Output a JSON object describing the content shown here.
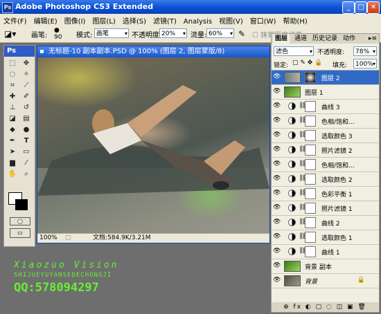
{
  "app": {
    "title": "Adobe Photoshop CS3 Extended",
    "logo": "Ps"
  },
  "window_controls": {
    "minimize": "_",
    "maximize": "□",
    "close": "✕"
  },
  "menu": [
    "文件(F)",
    "编辑(E)",
    "图像(I)",
    "图层(L)",
    "选择(S)",
    "滤镜(T)",
    "Analysis",
    "视图(V)",
    "窗口(W)",
    "帮助(H)"
  ],
  "options": {
    "brush_label": "画笔:",
    "brush_size": "90",
    "mode_label": "模式:",
    "mode_value": "画笔",
    "opacity_label": "不透明度:",
    "opacity_value": "20%",
    "flow_label": "流量:",
    "flow_value": "60%",
    "history_check_label": "抹到历史记录"
  },
  "toolbox": {
    "header": "Ps"
  },
  "document": {
    "title": "无标题-10 副本副本.PSD @ 100% (图层 2, 图层蒙版/8)",
    "zoom": "100%",
    "doc_info": "文档:584.9K/3.21M"
  },
  "layers_panel": {
    "tabs": [
      "图层",
      "通道",
      "历史记录",
      "动作"
    ],
    "blend_mode": "滤色",
    "opacity_label": "不透明度:",
    "opacity_value": "78%",
    "lock_label": "锁定:",
    "fill_label": "填充:",
    "fill_value": "100%",
    "layers": [
      {
        "name": "图层 2",
        "type": "pixel-mask",
        "selected": true
      },
      {
        "name": "图层 1",
        "type": "pixel"
      },
      {
        "name": "曲线 3",
        "type": "adjustment"
      },
      {
        "name": "色相/饱和...",
        "type": "adjustment"
      },
      {
        "name": "选取颜色 3",
        "type": "adjustment"
      },
      {
        "name": "照片滤镜 2",
        "type": "adjustment"
      },
      {
        "name": "色相/饱和...",
        "type": "adjustment"
      },
      {
        "name": "选取颜色 2",
        "type": "adjustment"
      },
      {
        "name": "色彩平衡 1",
        "type": "adjustment"
      },
      {
        "name": "照片滤镜 1",
        "type": "adjustment"
      },
      {
        "name": "曲线 2",
        "type": "adjustment"
      },
      {
        "name": "选取颜色 1",
        "type": "adjustment"
      },
      {
        "name": "曲线 1",
        "type": "adjustment"
      },
      {
        "name": "背景 副本",
        "type": "pixel"
      },
      {
        "name": "背景",
        "type": "background"
      }
    ],
    "bottom_icons": "⊕ fx ◐ ▢ ◌ ◫ ▣ 🗑"
  },
  "watermark": {
    "line1": "Xiaozuo Vision",
    "line2": "SHIJUEYUYANSEDECHONGJI",
    "line3": "QQ:578094297"
  }
}
